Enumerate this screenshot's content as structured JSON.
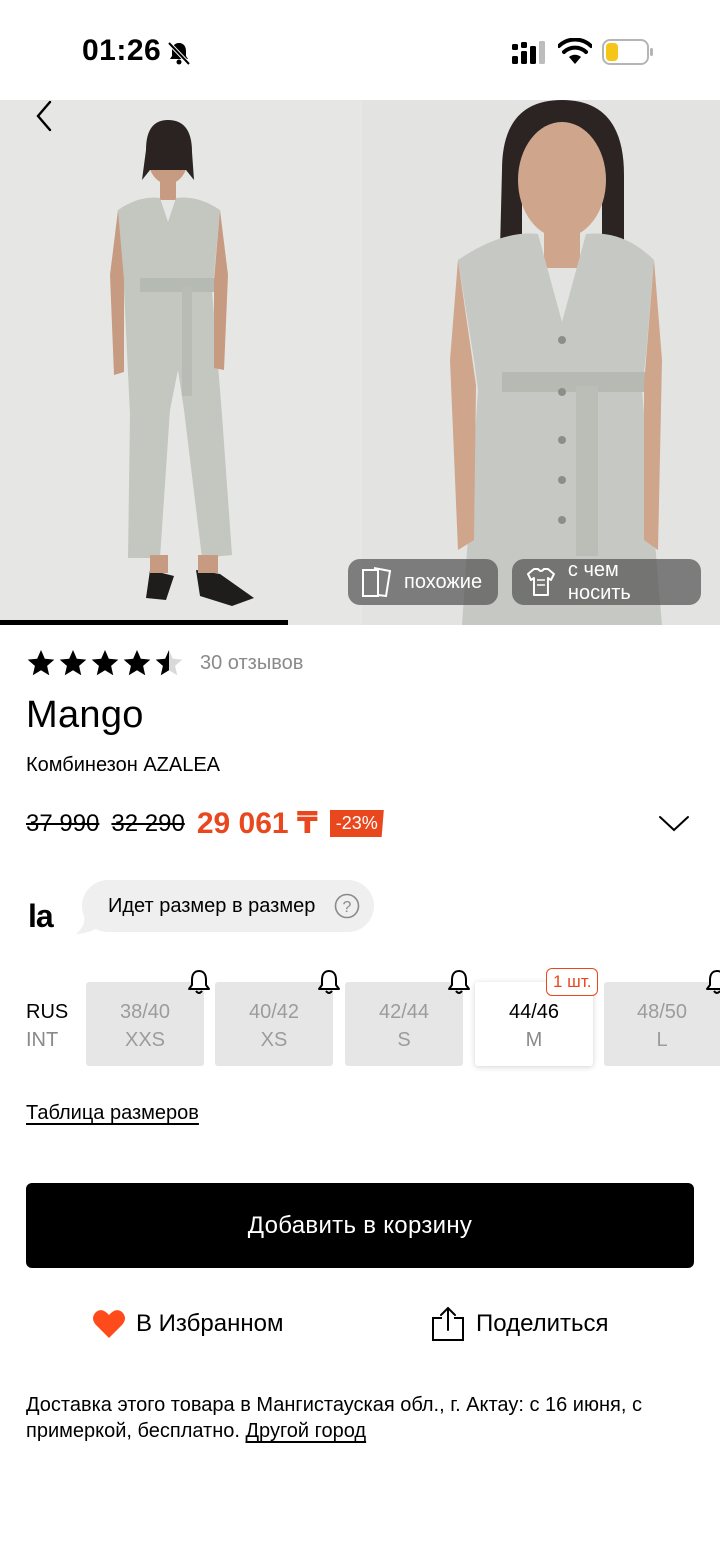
{
  "status_bar": {
    "time": "01:26",
    "icons": [
      "bell-slash-icon",
      "cellular-signal-icon",
      "wifi-icon",
      "battery-low-icon"
    ]
  },
  "gallery": {
    "progress_fraction": 0.4,
    "similar_label": "похожие",
    "wear_with_label": "с чем носить"
  },
  "product": {
    "rating": 4.5,
    "reviews": "30 отзывов",
    "brand": "Mango",
    "name": "Комбинезон AZALEA",
    "old_price_1": "37 990",
    "old_price_2": "32 290",
    "price": "29 061 ₸",
    "discount": "-23%"
  },
  "fit": {
    "logo": "la",
    "text": "Идет размер в размер"
  },
  "sizes": {
    "system_ru": "RUS",
    "system_int": "INT",
    "options": [
      {
        "ru": "38/40",
        "int": "XXS",
        "available": false
      },
      {
        "ru": "40/42",
        "int": "XS",
        "available": false
      },
      {
        "ru": "42/44",
        "int": "S",
        "available": false
      },
      {
        "ru": "44/46",
        "int": "M",
        "available": true,
        "stock": "1 шт."
      },
      {
        "ru": "48/50",
        "int": "L",
        "available": false
      }
    ],
    "table_link": "Таблица размеров"
  },
  "actions": {
    "add_to_cart": "Добавить в корзину",
    "favorite": "В Избранном",
    "share": "Поделиться"
  },
  "delivery": {
    "text": "Доставка этого товара в Мангистауская обл., г. Актау: с 16 июня, с примеркой, бесплатно.",
    "other_city": "Другой город"
  },
  "colors": {
    "accent": "#e9481f",
    "primary": "#000000",
    "chip_bg": "#e6e6e6"
  }
}
